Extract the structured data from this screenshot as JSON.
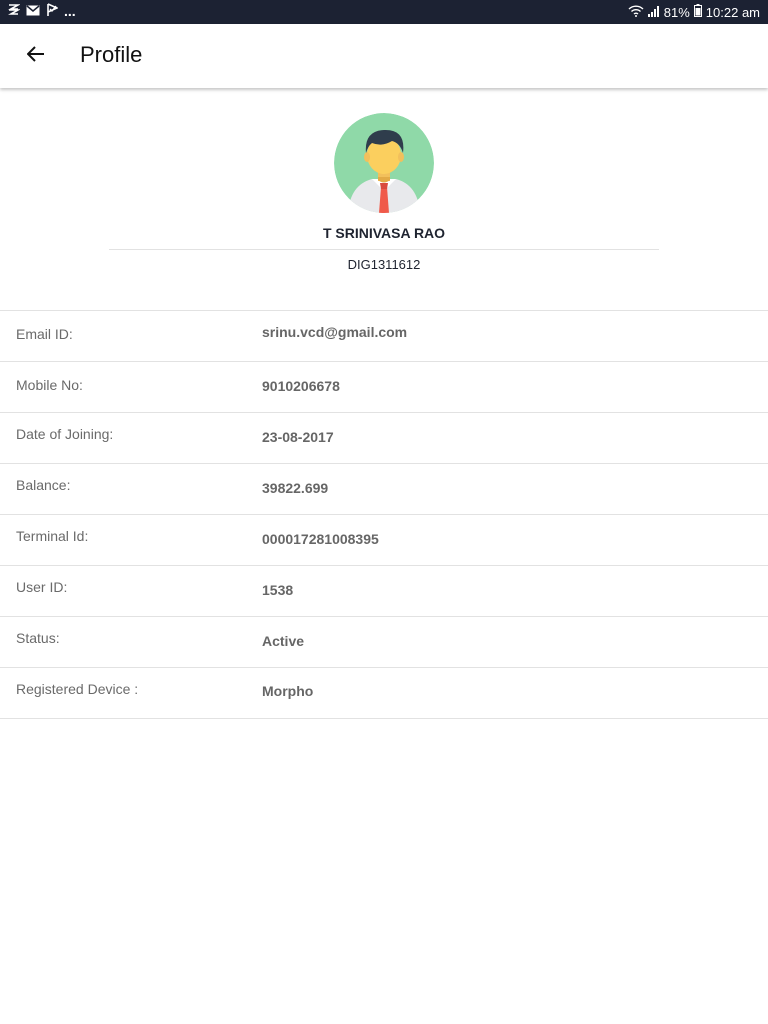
{
  "status_bar": {
    "left_icons": [
      "notification-icon",
      "mail-icon",
      "flag-icon"
    ],
    "more": "...",
    "battery": "81%",
    "time": "10:22 am"
  },
  "header": {
    "title": "Profile",
    "back_icon": "back-arrow-icon"
  },
  "profile": {
    "name": "T SRINIVASA RAO",
    "code": "DIG1311612",
    "avatar_icon": "user-avatar-icon"
  },
  "details": [
    {
      "label": "Email ID:",
      "value": "srinu.vcd@gmail.com"
    },
    {
      "label": "Mobile No:",
      "value": "9010206678"
    },
    {
      "label": "Date of Joining:",
      "value": "23-08-2017"
    },
    {
      "label": "Balance:",
      "value": "39822.699"
    },
    {
      "label": "Terminal Id:",
      "value": "000017281008395"
    },
    {
      "label": "User ID:",
      "value": "1538"
    },
    {
      "label": "Status:",
      "value": "Active"
    },
    {
      "label": "Registered Device :",
      "value": "Morpho"
    }
  ],
  "colors": {
    "status_bar_bg": "#1c2233",
    "avatar_bg": "#8fd9a8",
    "tie": "#f05a4a"
  }
}
